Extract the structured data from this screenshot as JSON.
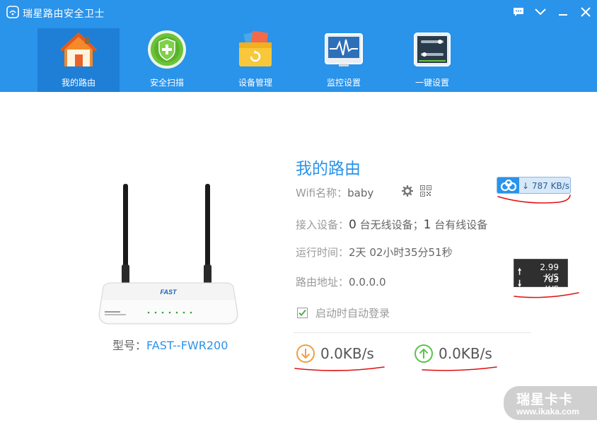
{
  "app": {
    "title": "瑞星路由安全卫士"
  },
  "nav": {
    "items": [
      {
        "label": "我的路由",
        "icon": "house-icon",
        "active": true
      },
      {
        "label": "安全扫描",
        "icon": "shield-icon",
        "active": false
      },
      {
        "label": "设备管理",
        "icon": "toolbox-icon",
        "active": false
      },
      {
        "label": "监控设置",
        "icon": "monitor-icon",
        "active": false
      },
      {
        "label": "一键设置",
        "icon": "router-settings-icon",
        "active": false
      }
    ]
  },
  "router": {
    "model_label": "型号：",
    "model_value": "FAST--FWR200"
  },
  "info": {
    "title": "我的路由",
    "wifi_label": "Wifi名称：",
    "wifi_value": "baby",
    "devices_label": "接入设备：",
    "wireless_count": "0",
    "wireless_text": "台无线设备；",
    "wired_count": "1",
    "wired_text": "台有线设备",
    "uptime_label": "运行时间：",
    "uptime_value": "2天 02小时35分51秒",
    "address_label": "路由地址：",
    "address_value": "0.0.0.0",
    "autologin_label": "启动时自动登录",
    "autologin_checked": true
  },
  "speeds": {
    "download": "0.0KB/s",
    "upload": "0.0KB/s"
  },
  "speed_badge": {
    "text": "787 KB/s"
  },
  "net_tooltip": {
    "up": "2.99 K/S",
    "down": "703 K/S"
  },
  "watermark": {
    "title": "瑞星卡卡",
    "url": "www.ikaka.com"
  },
  "colors": {
    "header": "#2a93ea",
    "active_tab": "#1f7fd6",
    "accent": "#2a93ea",
    "download": "#f0a040",
    "upload": "#5cc34e",
    "annotation": "#e01010"
  }
}
